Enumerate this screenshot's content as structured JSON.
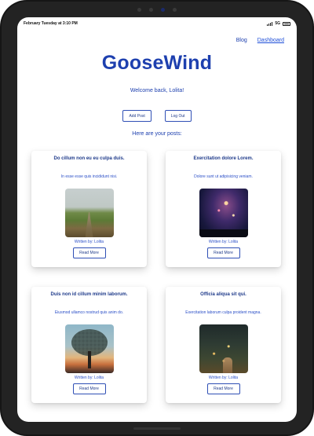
{
  "status_bar": {
    "datetime": "February Tuesday at 3:10 PM",
    "network": "5G"
  },
  "nav": {
    "blog_label": "Blog",
    "dashboard_label": "Dashboard"
  },
  "brand": {
    "title": "GooseWind"
  },
  "welcome_message": "Welcome back, Lolita!",
  "actions": {
    "add_post_label": "Add Post",
    "log_out_label": "Log Out"
  },
  "posts_heading": "Here are your posts:",
  "posts": [
    {
      "title": "Do cillum non eu eu culpa duis.",
      "body": "In esse esse quis incididunt nisi.",
      "image": "path-through-field-image",
      "author": "Written by: Lolita",
      "button_label": "Read More"
    },
    {
      "title": "Exercitation dolore Lorem.",
      "body": "Dolore sunt ut adipisicing veniam.",
      "image": "starry-night-image",
      "author": "Written by: Lolita",
      "button_label": "Read More"
    },
    {
      "title": "Duis non id cillum minim laborum.",
      "body": "Eiusmod ullamco nostrud quis anim do.",
      "image": "tree-sunset-image",
      "author": "Written by: Lolita",
      "button_label": "Read More"
    },
    {
      "title": "Officia aliqua sit qui.",
      "body": "Exercitation laborum culpa proident magna.",
      "image": "fireflies-hand-image",
      "author": "Written by: Lolita",
      "button_label": "Read More"
    }
  ],
  "colors": {
    "accent": "#1e40af",
    "button_border": "#2f4fb5",
    "text_body": "#2b4fc7"
  }
}
